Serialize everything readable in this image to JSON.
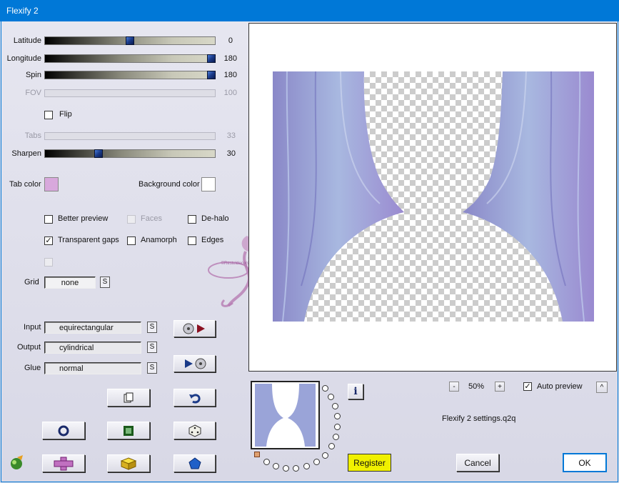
{
  "window": {
    "title": "Flexify 2"
  },
  "sliders": [
    {
      "label": "Latitude",
      "value": "0",
      "fraction": 0.5,
      "enabled": true
    },
    {
      "label": "Longitude",
      "value": "180",
      "fraction": 1.0,
      "enabled": true
    },
    {
      "label": "Spin",
      "value": "180",
      "fraction": 1.0,
      "enabled": true
    },
    {
      "label": "FOV",
      "value": "100",
      "fraction": 0,
      "enabled": false
    },
    {
      "label": "Tabs",
      "value": "33",
      "fraction": 0,
      "enabled": false
    },
    {
      "label": "Sharpen",
      "value": "30",
      "fraction": 0.3,
      "enabled": true
    }
  ],
  "flip": {
    "label": "Flip",
    "checked": false
  },
  "colors": {
    "tab_label": "Tab color",
    "tab_value": "#d8a8dc",
    "bg_label": "Background color",
    "bg_value": "#ffffff"
  },
  "options": {
    "better_preview": "Better preview",
    "faces": "Faces",
    "dehalo": "De-halo",
    "transparent_gaps": "Transparent gaps",
    "anamorph": "Anamorph",
    "edges": "Edges"
  },
  "grid": {
    "label": "Grid",
    "value": "none",
    "s": "S"
  },
  "projection": {
    "input_label": "Input",
    "input_value": "equirectangular",
    "output_label": "Output",
    "output_value": "cylindrical",
    "glue_label": "Glue",
    "glue_value": "normal",
    "s": "S"
  },
  "zoom": {
    "minus": "-",
    "value": "50%",
    "plus": "+"
  },
  "auto_preview": {
    "label": "Auto preview",
    "checked": true,
    "up": "^"
  },
  "info": {
    "icon": "i"
  },
  "settings_file": "Flexify 2 settings.q2q",
  "buttons": {
    "register": "Register",
    "cancel": "Cancel",
    "ok": "OK"
  },
  "watermark": "©Resteldecors Wien",
  "accent": "#0078d7"
}
